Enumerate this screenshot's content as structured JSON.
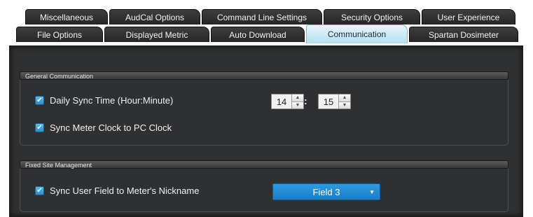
{
  "tabs_row1": [
    {
      "label": "Miscellaneous"
    },
    {
      "label": "AudCal Options"
    },
    {
      "label": "Command Line Settings"
    },
    {
      "label": "Security Options"
    },
    {
      "label": "User Experience"
    }
  ],
  "tabs_row2": [
    {
      "label": "File Options"
    },
    {
      "label": "Displayed Metric"
    },
    {
      "label": "Auto Download"
    },
    {
      "label": "Communication"
    },
    {
      "label": "Spartan Dosimeter"
    }
  ],
  "active_tab": "Communication",
  "general": {
    "title": "General Communication",
    "daily_sync_label": "Daily Sync Time (Hour:Minute)",
    "daily_sync_checked": true,
    "hour": "14",
    "separator": ":",
    "minute": "15",
    "sync_clock_label": "Sync Meter Clock to PC Clock",
    "sync_clock_checked": true
  },
  "fixed_site": {
    "title": "Fixed Site Management",
    "sync_user_label": "Sync User Field to Meter's Nickname",
    "sync_user_checked": true,
    "field_value": "Field 3"
  },
  "icons": {
    "checkmark": "check-icon",
    "spin_up": "chevron-up-icon",
    "spin_down": "chevron-down-icon",
    "dropdown": "caret-down-icon"
  },
  "colors": {
    "panel_bg": "#2f3031",
    "accent": "#2a8fcf",
    "active_tab": "#b3dff0"
  }
}
